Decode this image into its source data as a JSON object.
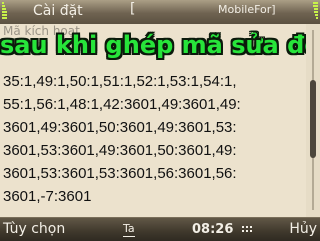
{
  "status_bar": {
    "app_title": "Cài đặt",
    "tab_separator": "[",
    "tab_name": "MobileFor]",
    "signal_icon": "signal-strength-icon",
    "battery_icon": "battery-level-icon"
  },
  "content": {
    "hidden_heading": "Mã kích hoạt",
    "overlay_caption": "sau khi ghép mã sửa đổ",
    "code_lines": [
      "35:1,49:1,50:1,51:1,52:1,53:1,54:1,",
      "55:1,56:1,48:1,42:3601,49:3601,49:",
      "3601,49:3601,50:3601,49:3601,53:",
      "3601,53:3601,49:3601,50:3601,49:",
      "3601,53:3601,53:3601,56:3601,56:",
      "3601,-7:3601"
    ]
  },
  "softkeys": {
    "left": "Tùy chọn",
    "input_mode": "Ta",
    "time": "08:26",
    "right": "Hủy"
  },
  "colors": {
    "background": "#ece2cd",
    "bar": "#5b5141",
    "caption": "#27e43a",
    "indicator": "#c8f24a"
  }
}
